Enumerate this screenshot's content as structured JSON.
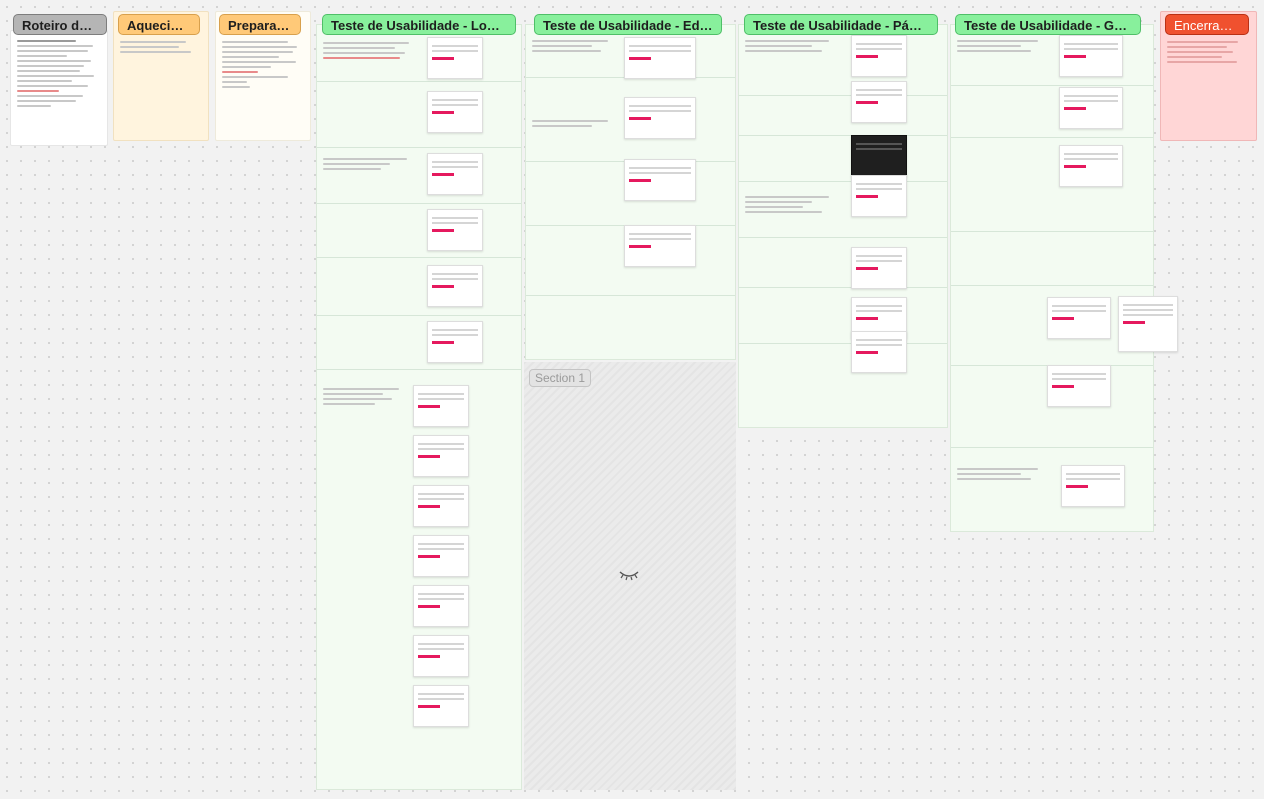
{
  "board": {
    "section_label": "Section 1"
  },
  "columns": [
    {
      "id": "roteiro",
      "title": "Roteiro do teste",
      "color": "gray"
    },
    {
      "id": "aquecimento",
      "title": "Aquecimento",
      "color": "orange"
    },
    {
      "id": "preparativo",
      "title": "Preparativo",
      "color": "orange"
    },
    {
      "id": "login",
      "title": "Teste de Usabilidade - Login Inte",
      "color": "green"
    },
    {
      "id": "edicao",
      "title": "Teste de Usabilidade - Edição do",
      "color": "green"
    },
    {
      "id": "pagina",
      "title": "Teste de Usabilidade - Página da",
      "color": "green"
    },
    {
      "id": "gestao",
      "title": "Teste de Usabilidade - Gestão d",
      "color": "green"
    },
    {
      "id": "encerramento",
      "title": "Encerramen",
      "color": "red"
    }
  ],
  "colors": {
    "canvas": "#f2f2f2",
    "sticky_yellow": "#fff4de",
    "sticky_light": "#fffdf6",
    "frame_green": "#f3fbf2",
    "frame_red": "#ffd6d6",
    "accent_pink": "#e5195e"
  },
  "icons": {
    "section_hidden": "eye-closed-icon"
  }
}
